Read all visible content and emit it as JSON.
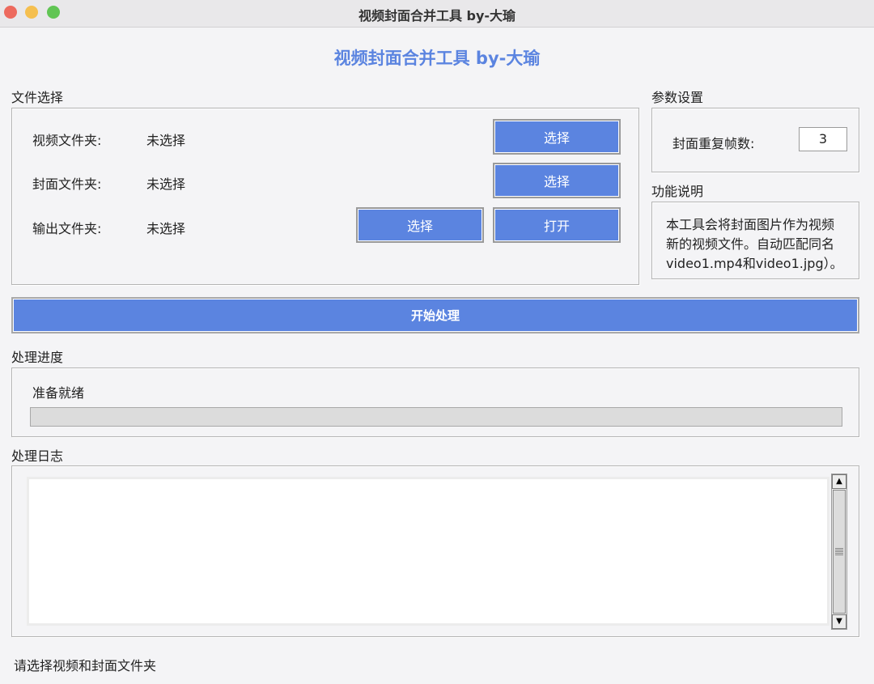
{
  "window": {
    "title": "视频封面合并工具 by-大瑜"
  },
  "app": {
    "title": "视频封面合并工具 by-大瑜"
  },
  "file_select": {
    "section_label": "文件选择",
    "video_folder": {
      "label": "视频文件夹:",
      "value": "未选择",
      "select_label": "选择"
    },
    "cover_folder": {
      "label": "封面文件夹:",
      "value": "未选择",
      "select_label": "选择"
    },
    "output_folder": {
      "label": "输出文件夹:",
      "value": "未选择",
      "select_label": "选择",
      "open_label": "打开"
    }
  },
  "params": {
    "section_label": "参数设置",
    "cover_repeat_label": "封面重复帧数:",
    "cover_repeat_value": "3"
  },
  "help": {
    "section_label": "功能说明",
    "lines": [
      "本工具会将封面图片作为视频",
      "新的视频文件。自动匹配同名",
      "video1.mp4和video1.jpg）。"
    ]
  },
  "start_button_label": "开始处理",
  "progress": {
    "section_label": "处理进度",
    "status": "准备就绪",
    "percent": 0
  },
  "log": {
    "section_label": "处理日志",
    "content": ""
  },
  "status_bar": {
    "text": "请选择视频和封面文件夹"
  },
  "colors": {
    "accent": "#5b84e0",
    "background": "#f4f4f6"
  }
}
